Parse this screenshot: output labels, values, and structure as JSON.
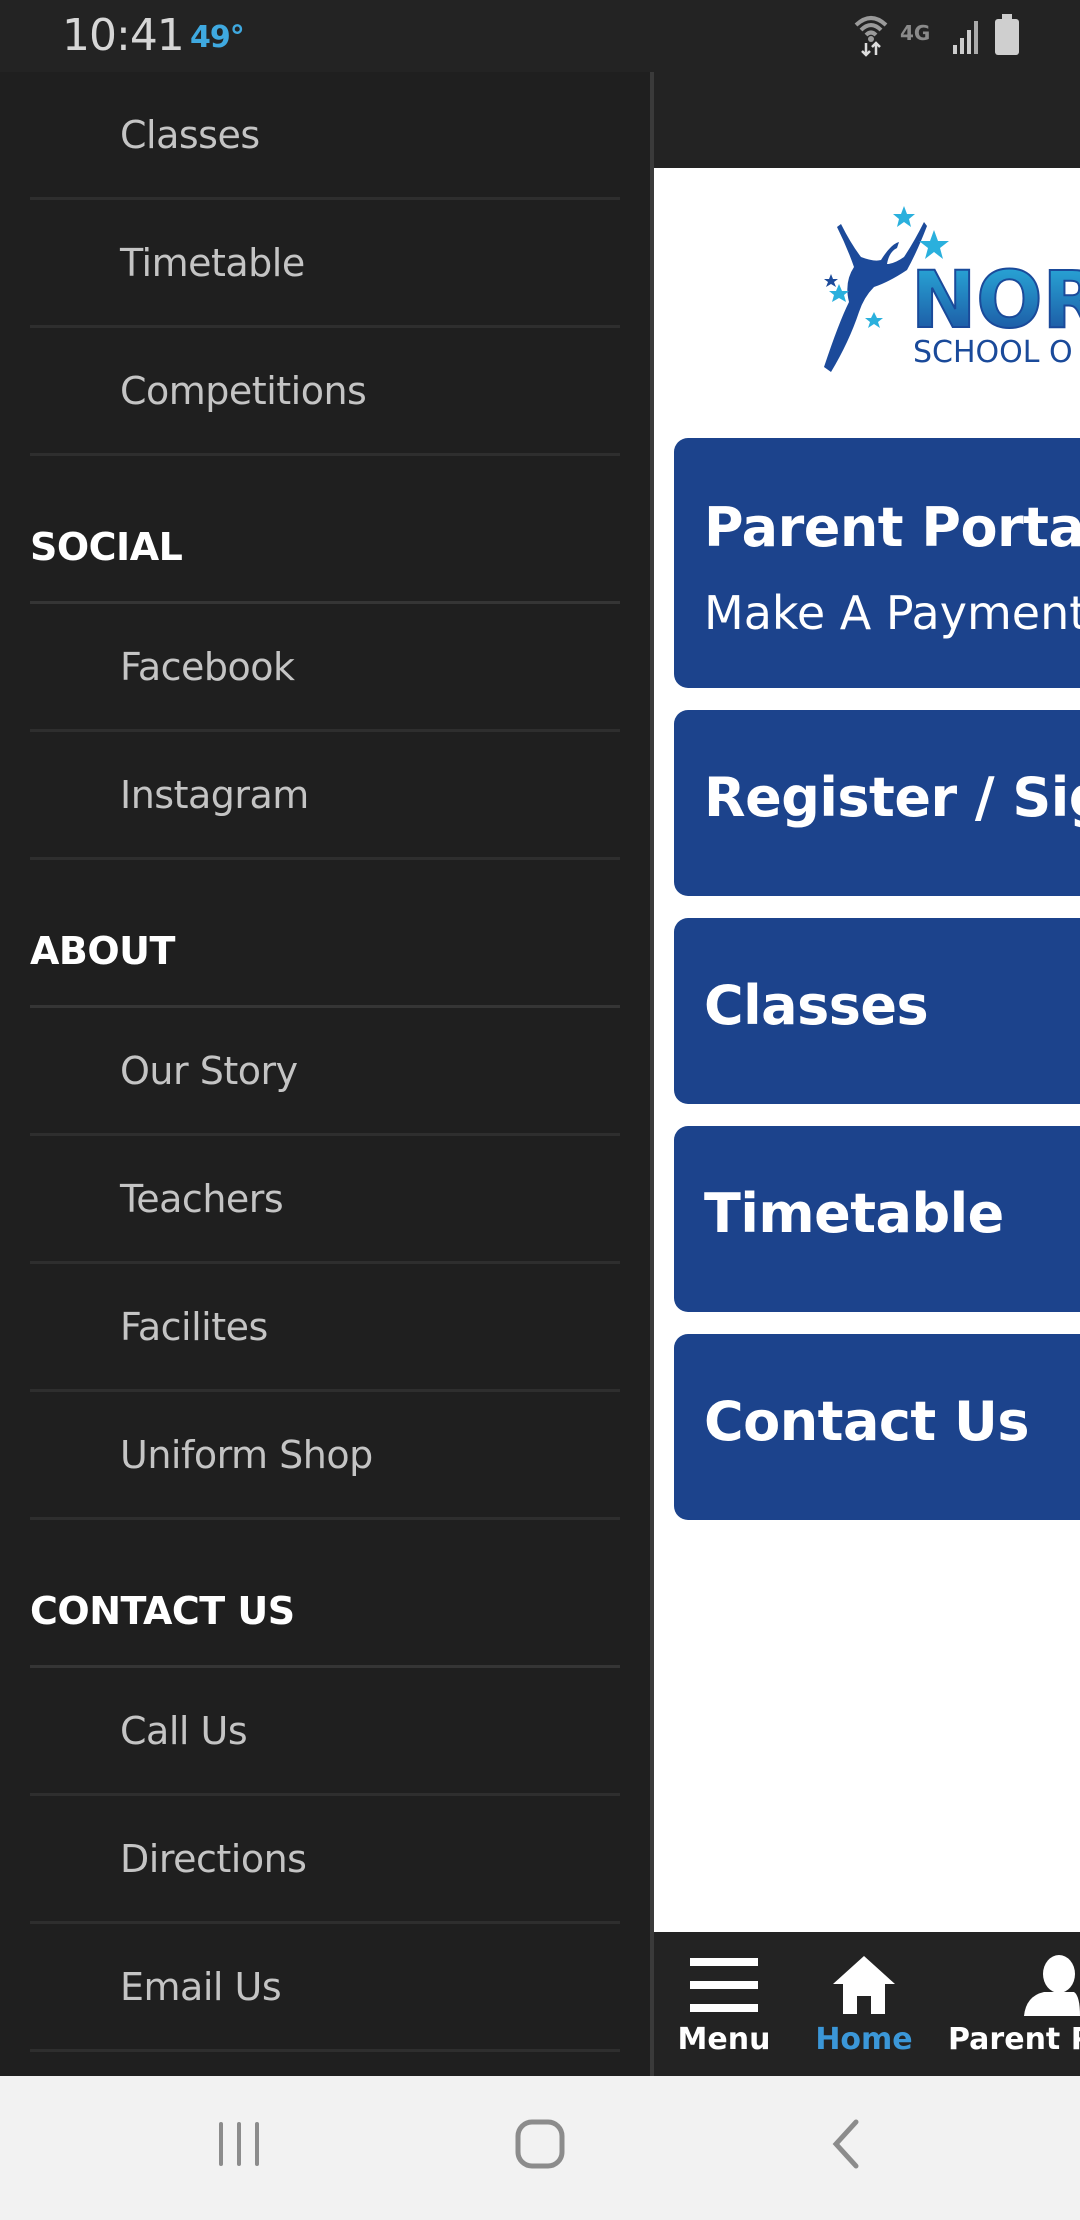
{
  "status_bar": {
    "time": "10:41",
    "temperature": "49°",
    "icons": [
      "wifi-icon",
      "lte-4g-icon",
      "signal-icon",
      "battery-icon"
    ],
    "network_label": "4G"
  },
  "drawer": {
    "sections": [
      {
        "header": null,
        "items": [
          "Classes",
          "Timetable",
          "Competitions"
        ]
      },
      {
        "header": "SOCIAL",
        "items": [
          "Facebook",
          "Instagram"
        ]
      },
      {
        "header": "ABOUT",
        "items": [
          "Our Story",
          "Teachers",
          "Facilites",
          "Uniform Shop"
        ]
      },
      {
        "header": "CONTACT US",
        "items": [
          "Call Us",
          "Directions",
          "Email Us"
        ]
      }
    ]
  },
  "main": {
    "logo": {
      "text": "NOR",
      "subtext": "SCHOOL O"
    },
    "tiles": [
      {
        "title": "Parent Portal",
        "subtitle": "Make A Payment"
      },
      {
        "title": "Register / Sign"
      },
      {
        "title": "Classes"
      },
      {
        "title": "Timetable"
      },
      {
        "title": "Contact Us"
      }
    ],
    "tabbar": [
      {
        "label": "Menu",
        "icon": "hamburger-menu-icon",
        "active": false
      },
      {
        "label": "Home",
        "icon": "home-icon",
        "active": true
      },
      {
        "label": "Parent P",
        "icon": "person-icon",
        "active": false
      }
    ]
  },
  "colors": {
    "tile_blue": "#1c438c",
    "active_tab": "#3b97d8",
    "drawer_bg": "#1f1f1f",
    "temperature": "#3fa9e0"
  },
  "system_nav": [
    "recent-apps-icon",
    "home-circle-icon",
    "back-icon"
  ]
}
